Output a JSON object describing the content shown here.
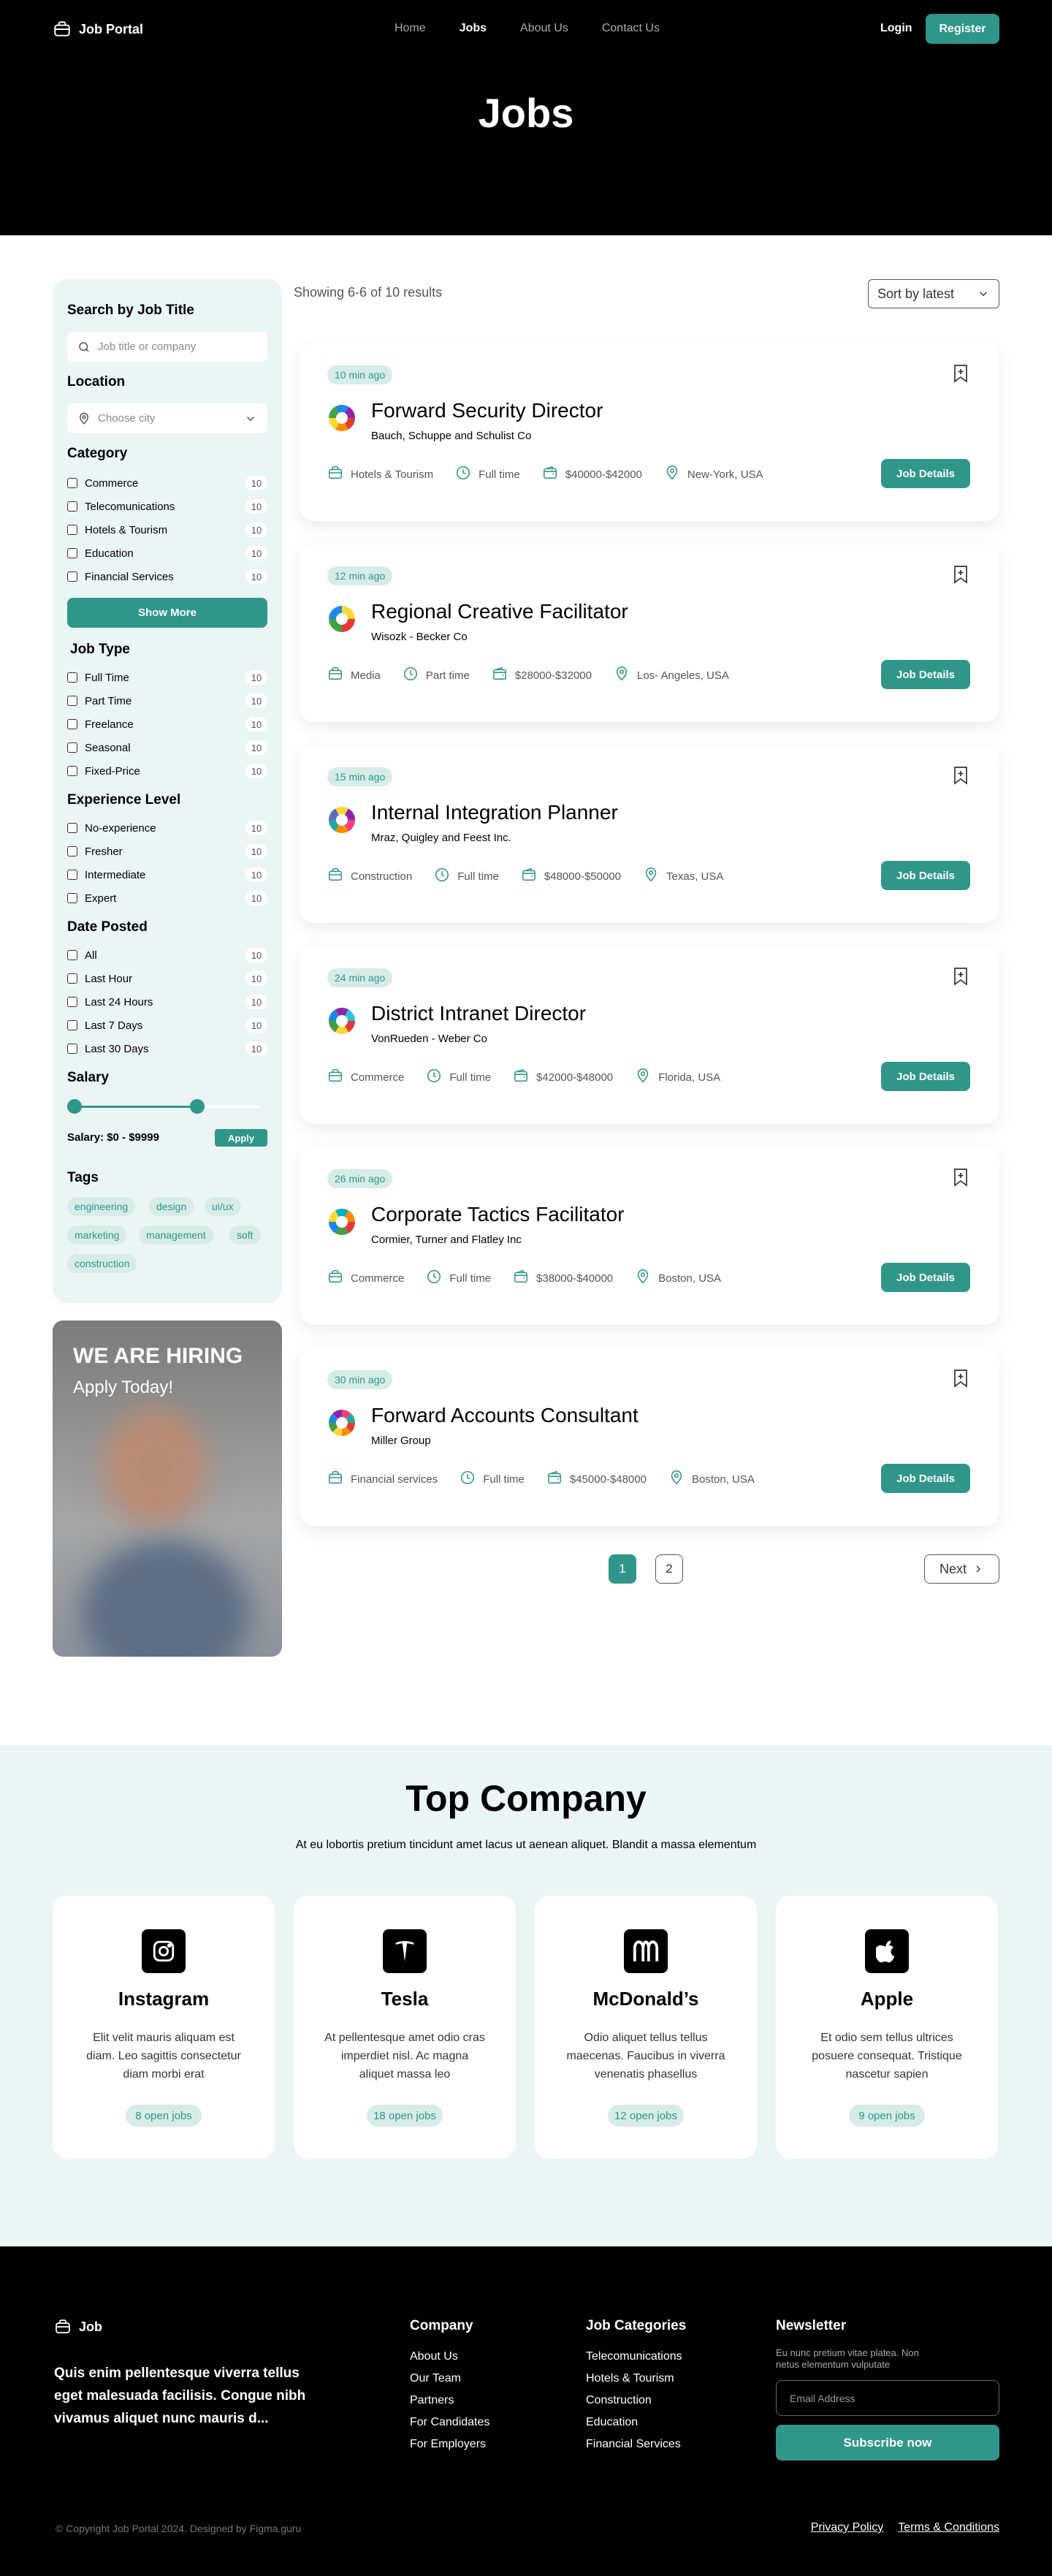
{
  "header": {
    "brand": "Job Portal",
    "nav": [
      "Home",
      "Jobs",
      "About Us",
      "Contact Us"
    ],
    "login": "Login",
    "register": "Register",
    "title": "Jobs"
  },
  "filters": {
    "search_title": "Search by Job Title",
    "search_placeholder": "Job title or company",
    "location_title": "Location",
    "location_placeholder": "Choose city",
    "category_title": "Category",
    "categories": [
      {
        "label": "Commerce",
        "count": "10"
      },
      {
        "label": "Telecomunications",
        "count": "10"
      },
      {
        "label": "Hotels & Tourism",
        "count": "10"
      },
      {
        "label": "Education",
        "count": "10"
      },
      {
        "label": "Financial Services",
        "count": "10"
      }
    ],
    "show_more": "Show More",
    "jobtype_title": "Job Type",
    "jobtypes": [
      {
        "label": "Full Time",
        "count": "10"
      },
      {
        "label": "Part Time",
        "count": "10"
      },
      {
        "label": "Freelance",
        "count": "10"
      },
      {
        "label": "Seasonal",
        "count": "10"
      },
      {
        "label": "Fixed-Price",
        "count": "10"
      }
    ],
    "experience_title": "Experience Level",
    "experience": [
      {
        "label": "No-experience",
        "count": "10"
      },
      {
        "label": "Fresher",
        "count": "10"
      },
      {
        "label": "Intermediate",
        "count": "10"
      },
      {
        "label": "Expert",
        "count": "10"
      }
    ],
    "date_title": "Date Posted",
    "dates": [
      {
        "label": "All",
        "count": "10"
      },
      {
        "label": "Last Hour",
        "count": "10"
      },
      {
        "label": "Last 24 Hours",
        "count": "10"
      },
      {
        "label": "Last 7 Days",
        "count": "10"
      },
      {
        "label": "Last 30 Days",
        "count": "10"
      }
    ],
    "salary_title": "Salary",
    "salary_text": "Salary: $0 - $9999",
    "salary_range_fraction": [
      0.0,
      0.66
    ],
    "apply": "Apply",
    "tags_title": "Tags",
    "tags": [
      "engineering",
      "design",
      "ui/ux",
      "marketing",
      "management",
      "soft",
      "construction"
    ]
  },
  "promo": {
    "line1": "WE ARE HIRING",
    "line2": "Apply Today!"
  },
  "results": {
    "showing": "Showing 6-6 of 10 results",
    "sort": "Sort by latest"
  },
  "jobs": [
    {
      "time": "10 min ago",
      "title": "Forward Security Director",
      "company": "Bauch, Schuppe and Schulist Co",
      "category": "Hotels & Tourism",
      "type": "Full time",
      "salary": "$40000-$42000",
      "location": "New-York, USA",
      "button": "Job Details"
    },
    {
      "time": "12 min ago",
      "title": "Regional Creative Facilitator",
      "company": "Wisozk - Becker Co",
      "category": "Media",
      "type": "Part time",
      "salary": "$28000-$32000",
      "location": "Los- Angeles, USA",
      "button": "Job Details"
    },
    {
      "time": "15 min ago",
      "title": "Internal Integration Planner",
      "company": "Mraz, Quigley and Feest Inc.",
      "category": "Construction",
      "type": "Full time",
      "salary": "$48000-$50000",
      "location": "Texas, USA",
      "button": "Job Details"
    },
    {
      "time": "24 min ago",
      "title": "District Intranet Director",
      "company": "VonRueden - Weber Co",
      "category": "Commerce",
      "type": "Full time",
      "salary": "$42000-$48000",
      "location": "Florida, USA",
      "button": "Job Details"
    },
    {
      "time": "26 min ago",
      "title": "Corporate Tactics Facilitator",
      "company": "Cormier, Turner and Flatley Inc",
      "category": "Commerce",
      "type": "Full time",
      "salary": "$38000-$40000",
      "location": "Boston, USA",
      "button": "Job Details"
    },
    {
      "time": "30 min ago",
      "title": "Forward Accounts Consultant",
      "company": "Miller Group",
      "category": "Financial services",
      "type": "Full time",
      "salary": "$45000-$48000",
      "location": "Boston, USA",
      "button": "Job Details"
    }
  ],
  "pagination": {
    "pages": [
      "1",
      "2"
    ],
    "next": "Next"
  },
  "top_company": {
    "title": "Top Company",
    "subtitle": "At eu lobortis pretium tincidunt amet lacus ut aenean aliquet. Blandit a massa elementum",
    "companies": [
      {
        "name": "Instagram",
        "desc": "Elit velit mauris aliquam est diam. Leo sagittis consectetur diam morbi erat",
        "jobs": "8 open jobs",
        "icon": "instagram-icon"
      },
      {
        "name": "Tesla",
        "desc": "At pellentesque amet odio cras imperdiet nisl. Ac magna aliquet massa leo",
        "jobs": "18 open jobs",
        "icon": "tesla-icon"
      },
      {
        "name": "McDonald’s",
        "desc": "Odio aliquet tellus tellus maecenas. Faucibus in viverra venenatis phasellus",
        "jobs": "12 open jobs",
        "icon": "mcdonalds-icon"
      },
      {
        "name": "Apple",
        "desc": "Et odio sem tellus ultrices posuere consequat. Tristique nascetur sapien",
        "jobs": "9 open jobs",
        "icon": "apple-icon"
      }
    ]
  },
  "footer": {
    "brand": "Job",
    "tagline": "Quis enim pellentesque viverra tellus eget malesuada facilisis. Congue nibh vivamus aliquet nunc mauris d...",
    "company_title": "Company",
    "company_links": [
      "About Us",
      "Our Team",
      "Partners",
      "For Candidates",
      "For Employers"
    ],
    "categories_title": "Job Categories",
    "categories_links": [
      "Telecomunications",
      "Hotels & Tourism",
      "Construction",
      "Education",
      "Financial Services"
    ],
    "newsletter_title": "Newsletter",
    "newsletter_text": "Eu nunc pretium vitae platea. Non netus elementum vulputate",
    "email_placeholder": "Email Address",
    "subscribe": "Subscribe now",
    "copyright": "© Copyright Job Portal  2024. Designed by Figma.guru",
    "privacy": "Privacy Policy",
    "terms": "Terms & Conditions"
  },
  "colors": {
    "accent": "#309689",
    "accent_light": "#ebf5f4",
    "dark": "#000000"
  }
}
